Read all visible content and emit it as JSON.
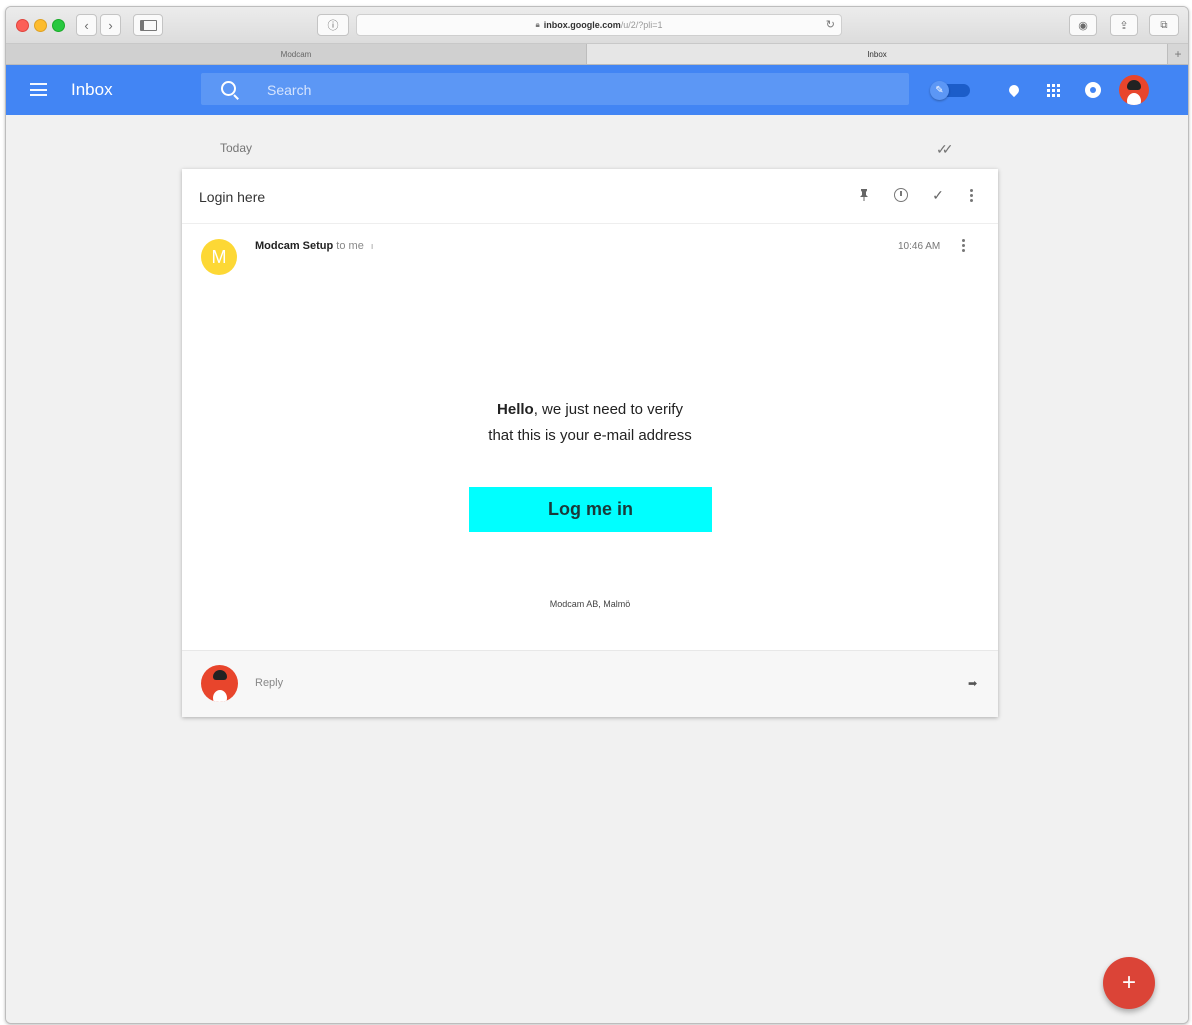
{
  "browser": {
    "url_host": "inbox.google.com",
    "url_path": "/u/2/?pli=1",
    "tabs": [
      {
        "label": "Modcam"
      },
      {
        "label": "Inbox"
      }
    ],
    "new_tab_label": "+"
  },
  "header": {
    "title": "Inbox",
    "search_placeholder": "Search",
    "accent_color": "#4285f4"
  },
  "inbox": {
    "section_label": "Today",
    "email": {
      "subject": "Login here",
      "sender_initial": "M",
      "sender_name": "Modcam Setup",
      "recipient": "to me",
      "time": "10:46 AM",
      "body_hello": "Hello",
      "body_line1_rest": ", we just need to verify",
      "body_line2": "that this is your e-mail address",
      "button_label": "Log me in",
      "button_color": "#00ffff",
      "footer": "Modcam AB, Malmö"
    },
    "reply_label": "Reply"
  },
  "fab": {
    "label": "+",
    "color": "#db4437"
  }
}
